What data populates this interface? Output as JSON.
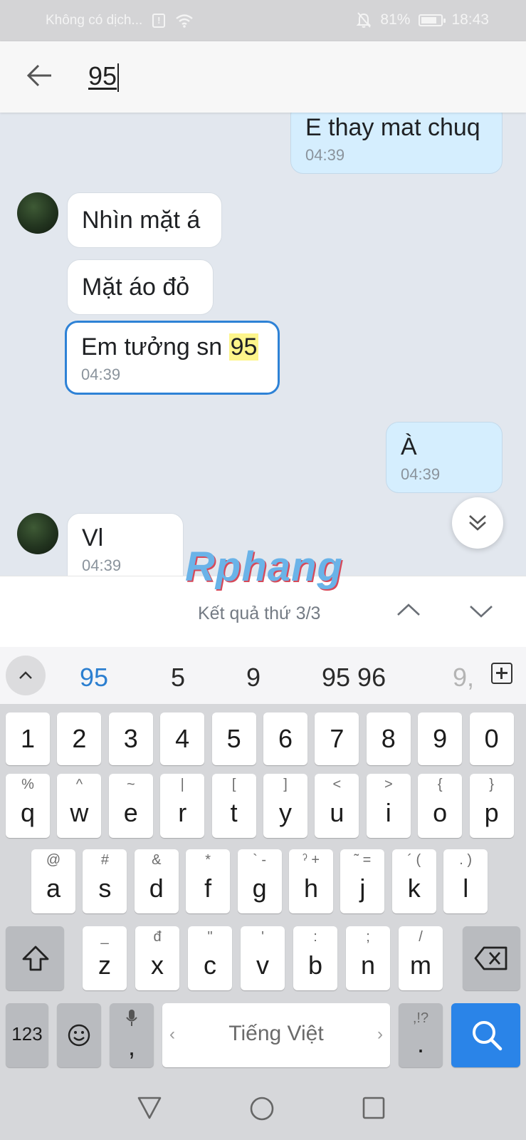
{
  "status_bar": {
    "carrier": "Không có dịch...",
    "battery": "81%",
    "battery_fill": 0.81,
    "time": "18:43"
  },
  "search": {
    "query": "95"
  },
  "messages": [
    {
      "dir": "out",
      "text": "E thay mat chuq",
      "time": "04:39"
    },
    {
      "dir": "in",
      "text": "Nhìn mặt á"
    },
    {
      "dir": "in",
      "text": "Mặt áo đỏ"
    },
    {
      "dir": "in",
      "text_before": "Em tưởng sn ",
      "text_match": "95",
      "time": "04:39"
    },
    {
      "dir": "out",
      "text": "À",
      "time": "04:39"
    },
    {
      "dir": "in",
      "text": "Vl",
      "time": "04:39"
    }
  ],
  "watermark": "Rphang",
  "results": {
    "label": "Kết quả thứ 3/3"
  },
  "suggestions": [
    "95",
    "5",
    "9",
    "95 96",
    "9,"
  ],
  "keyboard": {
    "numbers": [
      "1",
      "2",
      "3",
      "4",
      "5",
      "6",
      "7",
      "8",
      "9",
      "0"
    ],
    "row1": [
      {
        "main": "q",
        "sub": "%"
      },
      {
        "main": "w",
        "sub": "^"
      },
      {
        "main": "e",
        "sub": "~"
      },
      {
        "main": "r",
        "sub": "|"
      },
      {
        "main": "t",
        "sub": "["
      },
      {
        "main": "y",
        "sub": "]"
      },
      {
        "main": "u",
        "sub": "<"
      },
      {
        "main": "i",
        "sub": ">"
      },
      {
        "main": "o",
        "sub": "{"
      },
      {
        "main": "p",
        "sub": "}"
      }
    ],
    "row2": [
      {
        "main": "a",
        "sub": "@"
      },
      {
        "main": "s",
        "sub": "#"
      },
      {
        "main": "d",
        "sub": "&"
      },
      {
        "main": "f",
        "sub": "*"
      },
      {
        "main": "g",
        "sub": "` -"
      },
      {
        "main": "h",
        "sub": "ˀ +"
      },
      {
        "main": "j",
        "sub": "˜ ="
      },
      {
        "main": "k",
        "sub": "´ ("
      },
      {
        "main": "l",
        "sub": ". )"
      }
    ],
    "row3": [
      {
        "main": "z",
        "sub": "_"
      },
      {
        "main": "x",
        "sub": "đ"
      },
      {
        "main": "c",
        "sub": "\""
      },
      {
        "main": "v",
        "sub": "'"
      },
      {
        "main": "b",
        "sub": ":"
      },
      {
        "main": "n",
        "sub": ";"
      },
      {
        "main": "m",
        "sub": "/"
      }
    ],
    "numeric_label": "123",
    "comma_label": ",",
    "space_label": "Tiếng Việt",
    "period_label": ".",
    "period_sub": ",!?"
  }
}
